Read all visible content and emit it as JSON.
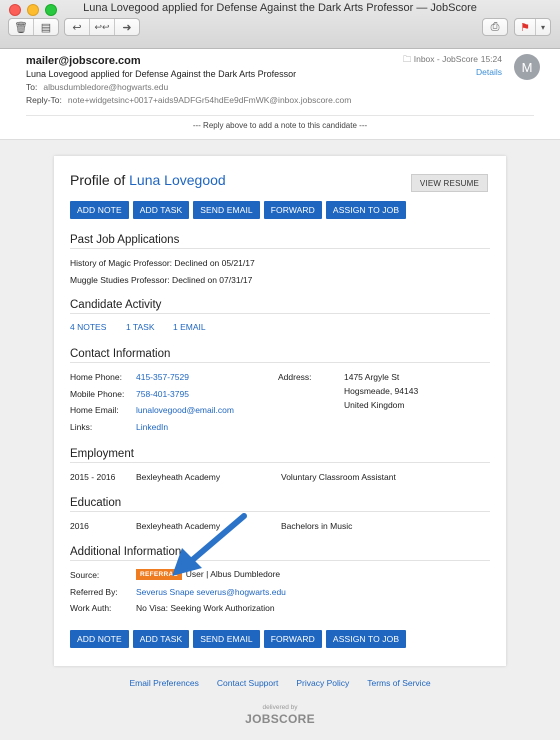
{
  "window": {
    "title": "Luna Lovegood applied for Defense Against the Dark Arts Professor — JobScore"
  },
  "toolbar": {
    "delete": "🗑",
    "archive": "▤",
    "reply": "↩",
    "reply_all": "↩↩",
    "forward": "➜",
    "print": "⎙",
    "flag": "⚑",
    "flag_menu": "▾"
  },
  "mail": {
    "from": "mailer@jobscore.com",
    "subject": "Luna Lovegood applied for Defense Against the Dark Arts Professor",
    "to_label": "To:",
    "to": "albusdumbledore@hogwarts.edu",
    "reply_to_label": "Reply-To:",
    "reply_to": "note+widgetsinc+0017+aids9ADFGr54hdEe9dFmWK@inbox.jobscore.com",
    "mailbox": "Inbox - JobScore",
    "time": "15:24",
    "details": "Details",
    "avatar": "M",
    "reply_note": "--- Reply above to add a note to this candidate ---"
  },
  "profile": {
    "title_prefix": "Profile of",
    "name": "Luna Lovegood",
    "view_resume": "VIEW RESUME",
    "actions": [
      "ADD NOTE",
      "ADD TASK",
      "SEND EMAIL",
      "FORWARD",
      "ASSIGN TO JOB"
    ],
    "past_apps_title": "Past Job Applications",
    "past_apps": [
      "History of Magic Professor: Declined on 05/21/17",
      "Muggle Studies Professor: Declined on 07/31/17"
    ],
    "activity_title": "Candidate Activity",
    "activity": [
      "4 NOTES",
      "1 TASK",
      "1 EMAIL"
    ],
    "contact_title": "Contact Information",
    "contact": {
      "home_phone_label": "Home Phone:",
      "home_phone": "415-357-7529",
      "mobile_phone_label": "Mobile Phone:",
      "mobile_phone": "758-401-3795",
      "home_email_label": "Home Email:",
      "home_email": "lunalovegood@email.com",
      "links_label": "Links:",
      "linkedin": "LinkedIn",
      "address_label": "Address:",
      "address_line1": "1475 Argyle St",
      "address_line2": "Hogsmeade, 94143",
      "address_line3": "United Kingdom"
    },
    "employment_title": "Employment",
    "employment": {
      "years": "2015 - 2016",
      "org": "Bexleyheath Academy",
      "role": "Voluntary Classroom Assistant"
    },
    "education_title": "Education",
    "education": {
      "year": "2016",
      "school": "Bexleyheath Academy",
      "degree": "Bachelors in Music"
    },
    "additional_title": "Additional Information",
    "additional": {
      "source_label": "Source:",
      "source_badge": "REFERRAL",
      "source_text": "User | Albus Dumbledore",
      "referred_label": "Referred By:",
      "referred_by": "Severus Snape severus@hogwarts.edu",
      "work_auth_label": "Work Auth:",
      "work_auth": "No Visa: Seeking Work Authorization"
    }
  },
  "footer": {
    "links": [
      "Email Preferences",
      "Contact Support",
      "Privacy Policy",
      "Terms of Service"
    ],
    "delivered_by": "delivered by",
    "logo": "JOBSCORE"
  },
  "colors": {
    "accent": "#1f66c1",
    "badge": "#f07c22",
    "arrow": "#2a73c9"
  }
}
